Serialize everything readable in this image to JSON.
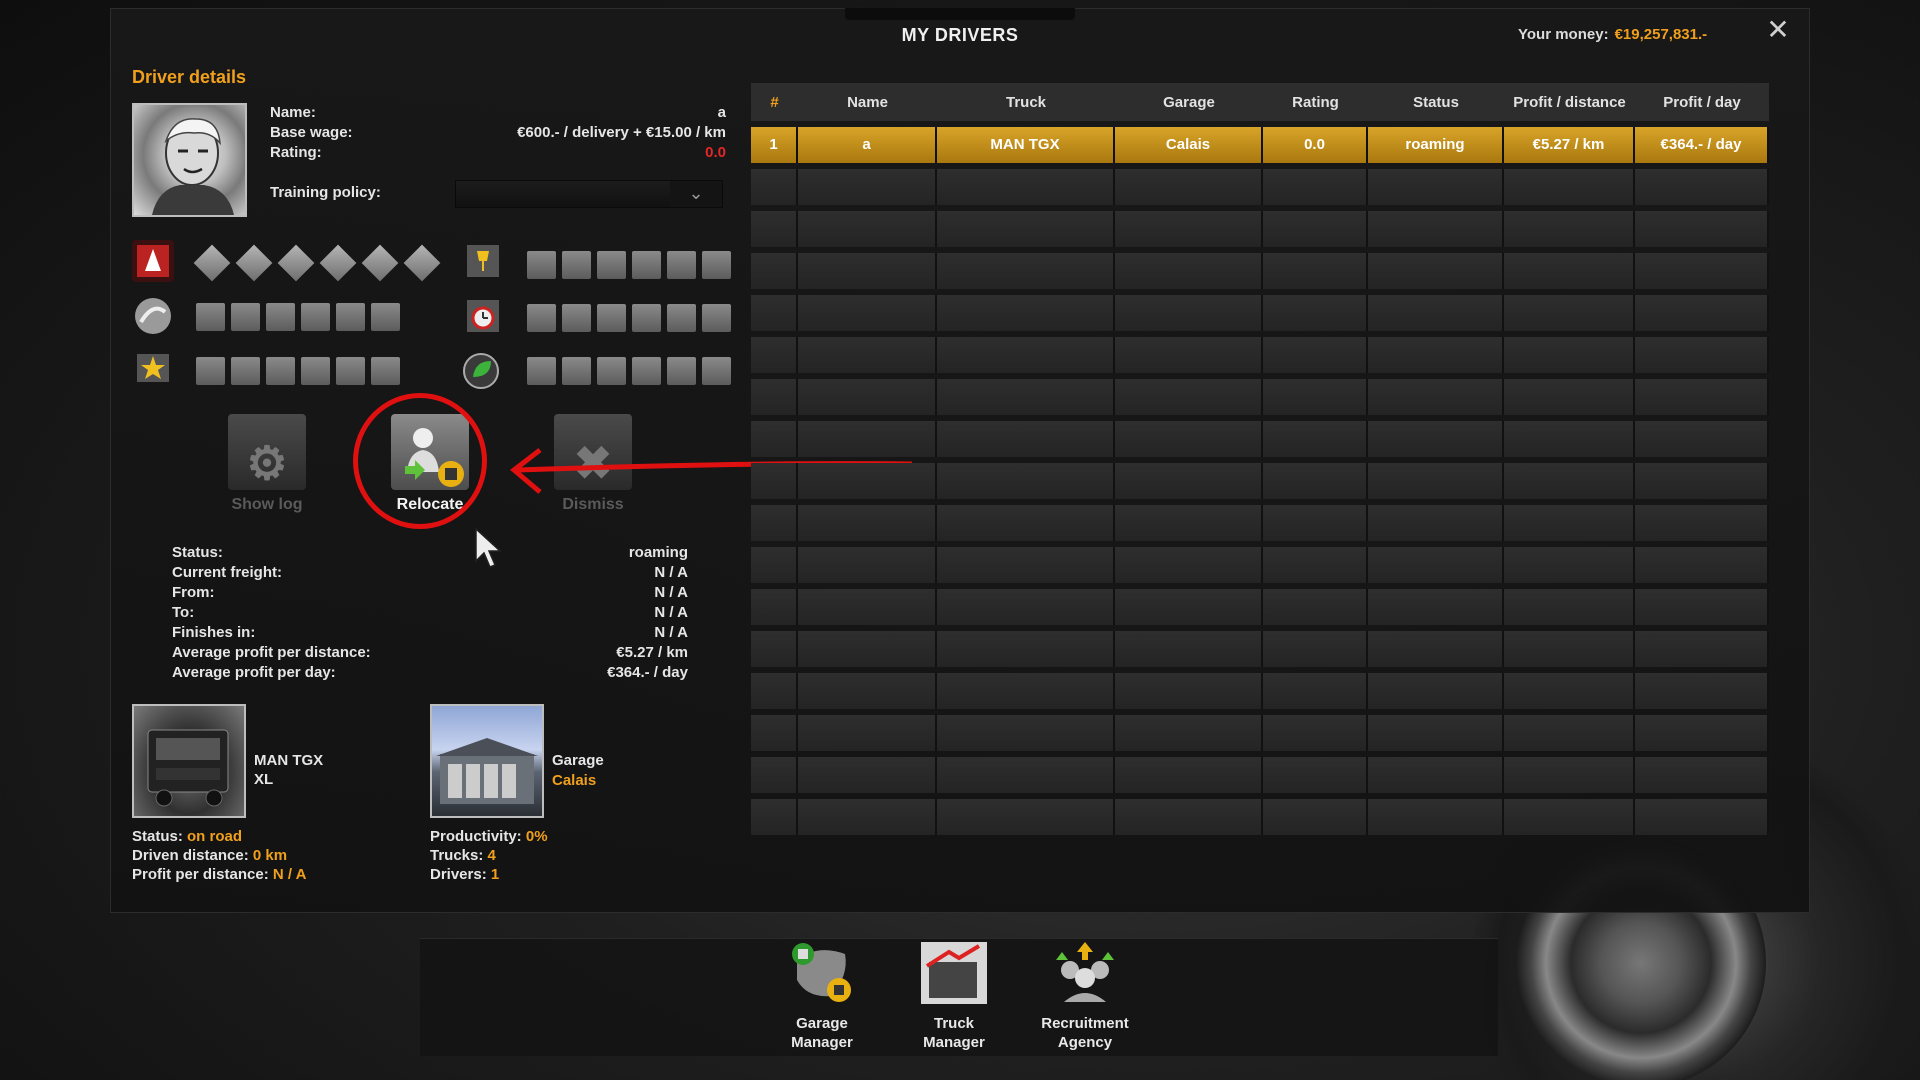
{
  "window": {
    "title": "MY DRIVERS",
    "money_label": "Your money:",
    "money_value": "€19,257,831.-",
    "close": "✕"
  },
  "driver": {
    "section_title": "Driver details",
    "name_label": "Name:",
    "name_value": "a",
    "wage_label": "Base wage:",
    "wage_value": "€600.- / delivery + €15.00 / km",
    "rating_label": "Rating:",
    "rating_value": "0.0",
    "policy_label": "Training policy:",
    "policy_value": ""
  },
  "actions": {
    "show_log": "Show log",
    "relocate": "Relocate",
    "dismiss": "Dismiss"
  },
  "status": {
    "rows": [
      {
        "label": "Status:",
        "value": "roaming"
      },
      {
        "label": "Current freight:",
        "value": "N / A"
      },
      {
        "label": "From:",
        "value": "N / A"
      },
      {
        "label": "To:",
        "value": "N / A"
      },
      {
        "label": "Finishes in:",
        "value": "N / A"
      },
      {
        "label": "Average profit per distance:",
        "value": "€5.27 / km"
      },
      {
        "label": "Average profit per day:",
        "value": "€364.- / day"
      }
    ]
  },
  "truck": {
    "name_line1": "MAN TGX",
    "name_line2": "XL",
    "status_label": "Status:",
    "status_value": "on road",
    "distance_label": "Driven distance:",
    "distance_value": "0 km",
    "profit_label": "Profit per distance:",
    "profit_value": "N / A"
  },
  "garage": {
    "title": "Garage",
    "city": "Calais",
    "productivity_label": "Productivity:",
    "productivity_value": "0%",
    "trucks_label": "Trucks:",
    "trucks_value": "4",
    "drivers_label": "Drivers:",
    "drivers_value": "1"
  },
  "table": {
    "headers": [
      "#",
      "Name",
      "Truck",
      "Garage",
      "Rating",
      "Status",
      "Profit / distance",
      "Profit / day"
    ],
    "rows": [
      [
        "1",
        "a",
        "MAN TGX",
        "Calais",
        "0.0",
        "roaming",
        "€5.27 / km",
        "€364.- / day"
      ]
    ],
    "empty_rows": 16
  },
  "bottom_nav": {
    "garage_manager": [
      "Garage",
      "Manager"
    ],
    "truck_manager": [
      "Truck",
      "Manager"
    ],
    "recruitment": [
      "Recruitment",
      "Agency"
    ]
  },
  "colors": {
    "accent": "#f0a01c",
    "selected_row": "#c99420",
    "red_annotation": "#e01010",
    "rating_red": "#e02828"
  },
  "icons": [
    "close-icon",
    "chevron-down-icon",
    "adr-skill-icon",
    "long-distance-skill-icon",
    "high-value-skill-icon",
    "fragile-skill-icon",
    "just-in-time-skill-icon",
    "ecodriving-skill-icon"
  ]
}
